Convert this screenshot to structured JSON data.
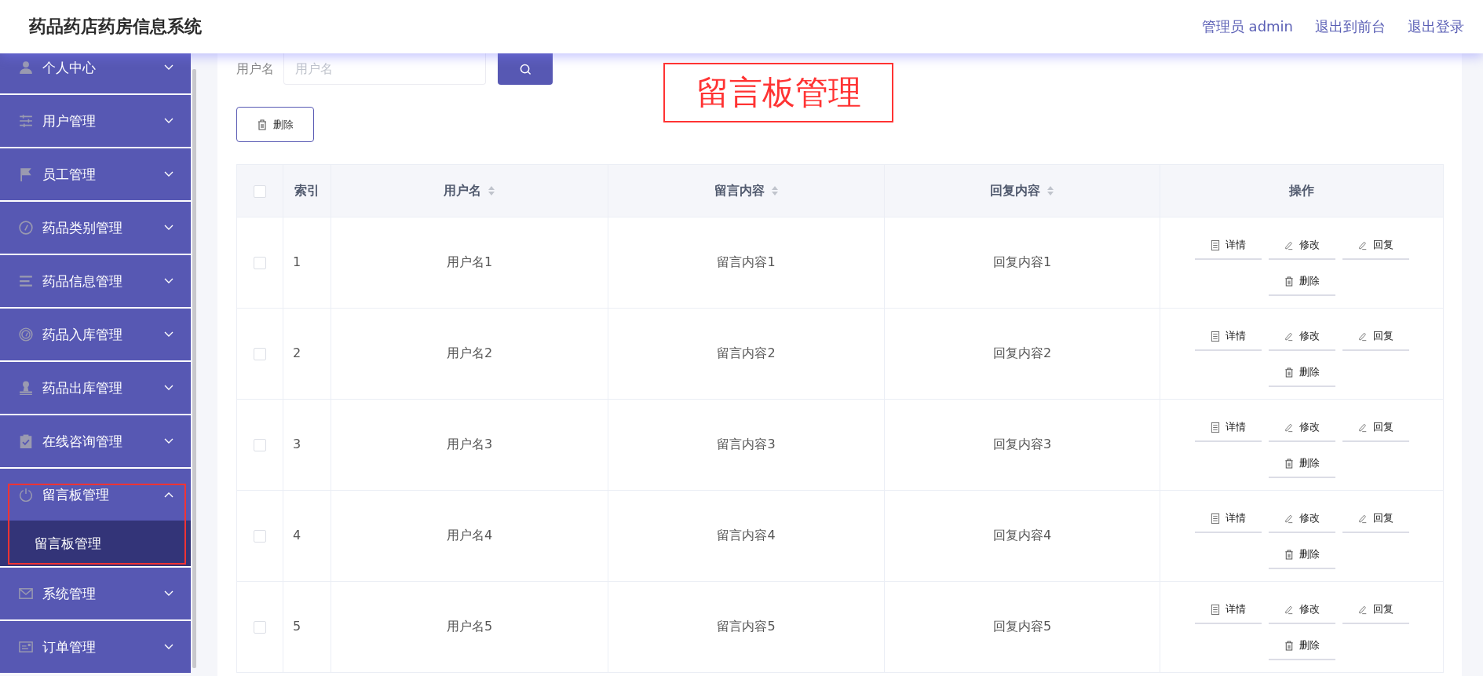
{
  "header": {
    "title": "药品药店药房信息系统",
    "links": [
      {
        "label": "管理员 admin"
      },
      {
        "label": "退出到前台"
      },
      {
        "label": "退出登录"
      }
    ]
  },
  "sidebar": {
    "items": [
      {
        "label": "个人中心",
        "expanded": false,
        "annotated": false
      },
      {
        "label": "用户管理",
        "expanded": false,
        "annotated": false
      },
      {
        "label": "员工管理",
        "expanded": false,
        "annotated": false
      },
      {
        "label": "药品类别管理",
        "expanded": false,
        "annotated": false
      },
      {
        "label": "药品信息管理",
        "expanded": false,
        "annotated": false
      },
      {
        "label": "药品入库管理",
        "expanded": false,
        "annotated": false
      },
      {
        "label": "药品出库管理",
        "expanded": false,
        "annotated": false
      },
      {
        "label": "在线咨询管理",
        "expanded": false,
        "annotated": false
      },
      {
        "label": "留言板管理",
        "expanded": true,
        "annotated": true,
        "children": [
          {
            "label": "留言板管理",
            "selected": true
          }
        ]
      },
      {
        "label": "系统管理",
        "expanded": false,
        "annotated": false
      },
      {
        "label": "订单管理",
        "expanded": false,
        "annotated": false
      }
    ]
  },
  "search": {
    "label": "用户名",
    "placeholder": "用户名"
  },
  "toolbar": {
    "delete_label": "删除"
  },
  "annotation": {
    "label": "留言板管理"
  },
  "table": {
    "select_all": {
      "checked": false
    },
    "columns": [
      {
        "label": "索引",
        "sortable": false
      },
      {
        "label": "用户名",
        "sortable": true
      },
      {
        "label": "留言内容",
        "sortable": true
      },
      {
        "label": "回复内容",
        "sortable": true
      },
      {
        "label": "操作",
        "sortable": false
      }
    ],
    "rows": [
      {
        "checked": false,
        "cells": [
          "1",
          "用户名1",
          "留言内容1",
          "回复内容1"
        ],
        "actions": [
          {
            "kind": "detail",
            "label": "详情"
          },
          {
            "kind": "edit",
            "label": "修改"
          },
          {
            "kind": "reply",
            "label": "回复"
          },
          {
            "kind": "delete",
            "label": "删除"
          }
        ]
      },
      {
        "checked": false,
        "cells": [
          "2",
          "用户名2",
          "留言内容2",
          "回复内容2"
        ],
        "actions": [
          {
            "kind": "detail",
            "label": "详情"
          },
          {
            "kind": "edit",
            "label": "修改"
          },
          {
            "kind": "reply",
            "label": "回复"
          },
          {
            "kind": "delete",
            "label": "删除"
          }
        ]
      },
      {
        "checked": false,
        "cells": [
          "3",
          "用户名3",
          "留言内容3",
          "回复内容3"
        ],
        "actions": [
          {
            "kind": "detail",
            "label": "详情"
          },
          {
            "kind": "edit",
            "label": "修改"
          },
          {
            "kind": "reply",
            "label": "回复"
          },
          {
            "kind": "delete",
            "label": "删除"
          }
        ]
      },
      {
        "checked": false,
        "cells": [
          "4",
          "用户名4",
          "留言内容4",
          "回复内容4"
        ],
        "actions": [
          {
            "kind": "detail",
            "label": "详情"
          },
          {
            "kind": "edit",
            "label": "修改"
          },
          {
            "kind": "reply",
            "label": "回复"
          },
          {
            "kind": "delete",
            "label": "删除"
          }
        ]
      },
      {
        "checked": false,
        "cells": [
          "5",
          "用户名5",
          "留言内容5",
          "回复内容5"
        ],
        "actions": [
          {
            "kind": "detail",
            "label": "详情"
          },
          {
            "kind": "edit",
            "label": "修改"
          },
          {
            "kind": "reply",
            "label": "回复"
          },
          {
            "kind": "delete",
            "label": "删除"
          }
        ]
      }
    ]
  }
}
